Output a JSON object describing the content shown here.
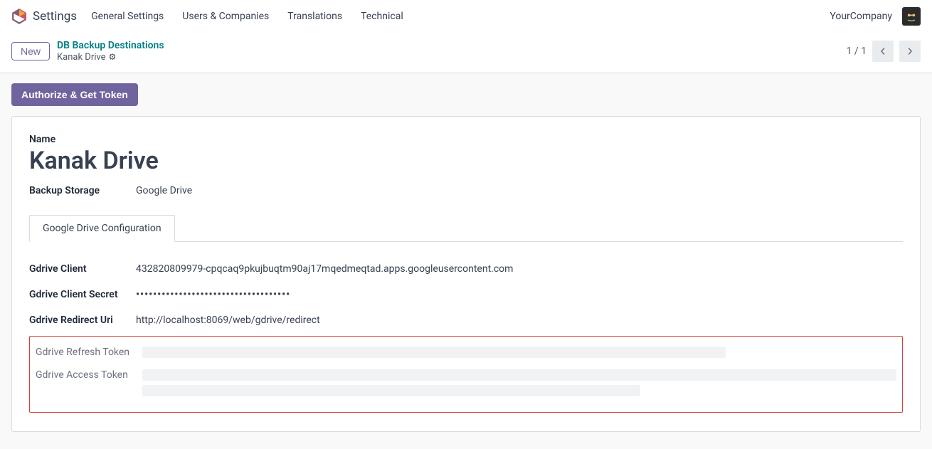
{
  "nav": {
    "app": "Settings",
    "items": [
      "General Settings",
      "Users & Companies",
      "Translations",
      "Technical"
    ],
    "company": "YourCompany"
  },
  "controlbar": {
    "new_label": "New",
    "breadcrumb_parent": "DB Backup Destinations",
    "breadcrumb_current": "Kanak Drive",
    "pager_text": "1 / 1"
  },
  "actions": {
    "authorize_label": "Authorize & Get Token"
  },
  "form": {
    "name_label": "Name",
    "name_value": "Kanak Drive",
    "storage_label": "Backup Storage",
    "storage_value": "Google Drive",
    "tab_label": "Google Drive Configuration",
    "rows": {
      "client_label": "Gdrive Client",
      "client_value": "432820809979-cpqcaq9pkujbuqtm90aj17mqedmeqtad.apps.googleusercontent.com",
      "secret_label": "Gdrive Client Secret",
      "secret_value": "••••••••••••••••••••••••••••••••••••",
      "redirect_label": "Gdrive Redirect Uri",
      "redirect_value": "http://localhost:8069/web/gdrive/redirect",
      "refresh_label": "Gdrive Refresh Token",
      "access_label": "Gdrive Access Token"
    }
  }
}
